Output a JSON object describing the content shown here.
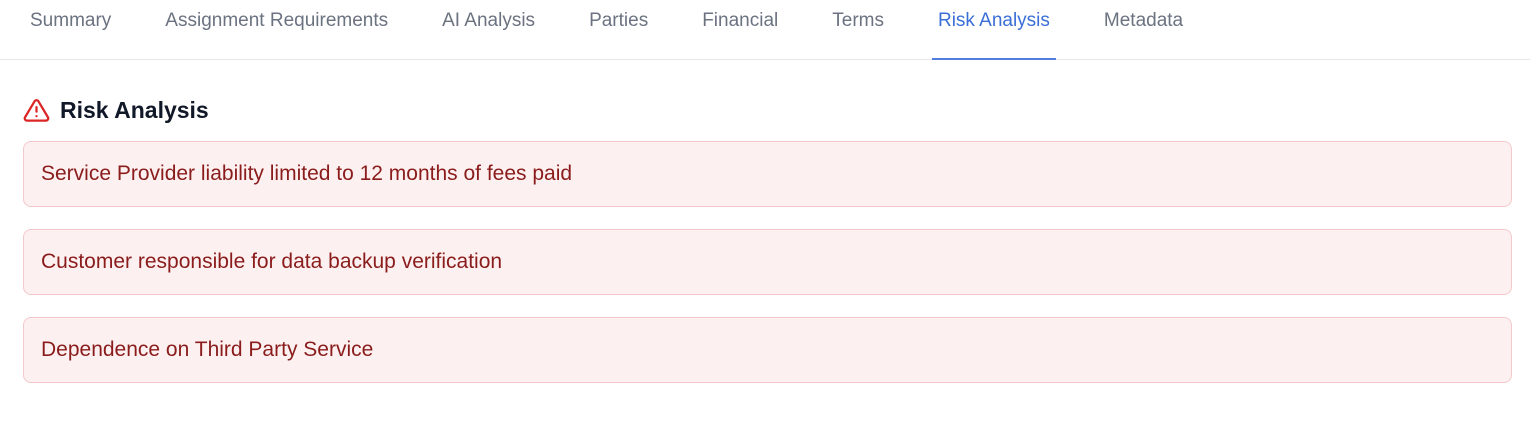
{
  "tabs": [
    {
      "label": "Summary",
      "active": false
    },
    {
      "label": "Assignment Requirements",
      "active": false
    },
    {
      "label": "AI Analysis",
      "active": false
    },
    {
      "label": "Parties",
      "active": false
    },
    {
      "label": "Financial",
      "active": false
    },
    {
      "label": "Terms",
      "active": false
    },
    {
      "label": "Risk Analysis",
      "active": true
    },
    {
      "label": "Metadata",
      "active": false
    }
  ],
  "section": {
    "title": "Risk Analysis",
    "icon": "warning-triangle-icon"
  },
  "risks": [
    "Service Provider liability limited to 12 months of fees paid",
    "Customer responsible for data backup verification",
    "Dependence on Third Party Service"
  ],
  "colors": {
    "accent": "#3b6fd8",
    "risk_text": "#8a1c1c",
    "risk_bg": "#fdf0f0",
    "risk_border": "#f4c9cb",
    "warning_icon": "#dc2626"
  }
}
